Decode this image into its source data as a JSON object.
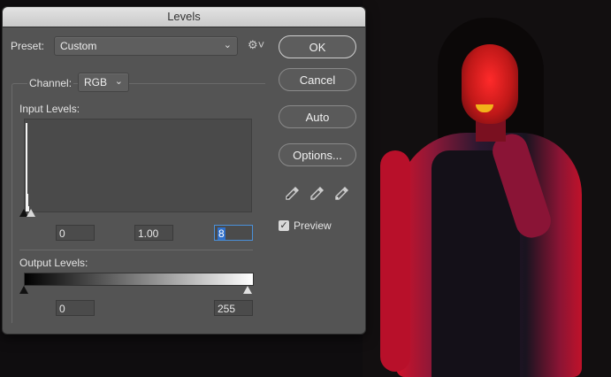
{
  "dialog": {
    "title": "Levels",
    "preset_label": "Preset:",
    "preset_value": "Custom",
    "channel_label": "Channel:",
    "channel_value": "RGB",
    "input_levels_label": "Input Levels:",
    "input_black": "0",
    "input_gamma": "1.00",
    "input_white": "8",
    "output_levels_label": "Output Levels:",
    "output_black": "0",
    "output_white": "255"
  },
  "buttons": {
    "ok": "OK",
    "cancel": "Cancel",
    "auto": "Auto",
    "options": "Options..."
  },
  "preview": {
    "label": "Preview",
    "checked": true
  },
  "icons": [
    "gear-icon",
    "black-eyedropper-icon",
    "gray-eyedropper-icon",
    "white-eyedropper-icon",
    "checkmark-icon",
    "chevron-down-icon"
  ],
  "colors": {
    "dialog_bg": "#545454",
    "accent_blue": "#2f6fc9"
  }
}
